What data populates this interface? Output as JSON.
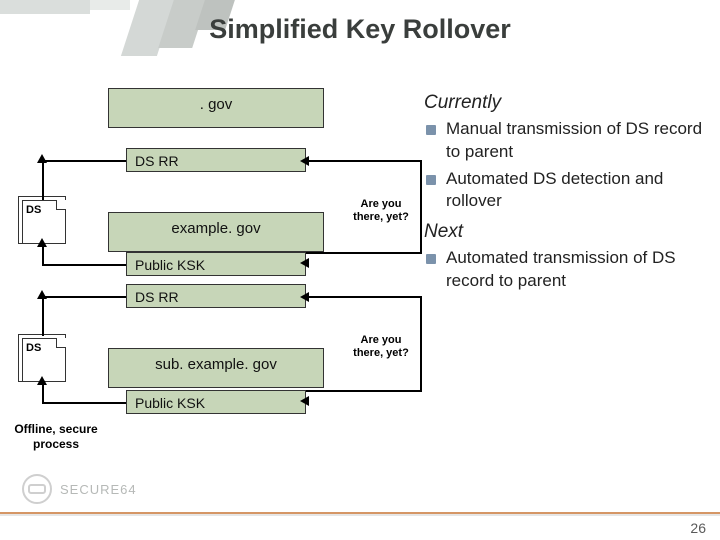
{
  "title": "Simplified Key Rollover",
  "zones": {
    "gov": ". gov",
    "example": "example. gov",
    "sub": "sub. example. gov"
  },
  "boxes": {
    "dsrr1": "DS RR",
    "dsrr2": "DS RR",
    "publicksk1": "Public KSK",
    "publicksk2": "Public KSK"
  },
  "ds_doc_label": "DS",
  "are_you_there1_a": "Are you",
  "are_you_there1_b": "there, yet?",
  "are_you_there2_a": "Are you",
  "are_you_there2_b": "there, yet?",
  "offline_a": "Offline, secure",
  "offline_b": "process",
  "right": {
    "currently": "Currently",
    "b1": "Manual transmission of DS record to parent",
    "b2": "Automated DS detection and rollover",
    "next": "Next",
    "b3": "Automated transmission of DS record to parent"
  },
  "footer": {
    "brand": "SECURE64",
    "page": "26"
  }
}
